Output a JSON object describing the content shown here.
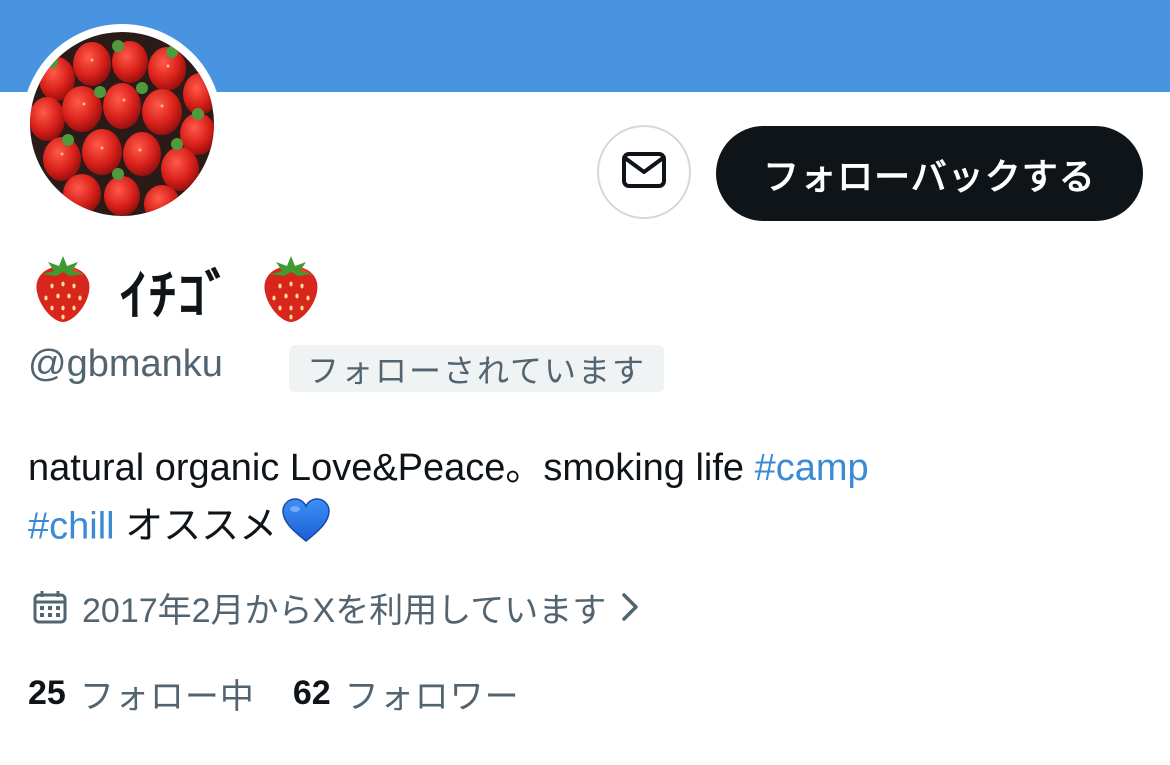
{
  "profile": {
    "display_name": "ｲﾁｺﾞ",
    "name_emoji": "strawberry-icon",
    "handle": "@gbmanku",
    "follows_you": "フォローされています",
    "bio": {
      "text_1": "natural organic Love&Peace。smoking life ",
      "hashtag_1": "#camp",
      "hashtag_2": "#chill",
      "text_2": " オススメ",
      "emoji": "blue-heart-icon"
    },
    "joined": "2017年2月からXを利用しています",
    "following_count": "25",
    "following_label": "フォロー中",
    "followers_count": "62",
    "followers_label": "フォロワー"
  },
  "actions": {
    "message_icon": "envelope-icon",
    "follow_back_label": "フォローバックする"
  },
  "colors": {
    "banner": "#4994e0",
    "follow_button_bg": "#0f1419",
    "link": "#3a8ad6",
    "secondary_text": "#536471"
  }
}
